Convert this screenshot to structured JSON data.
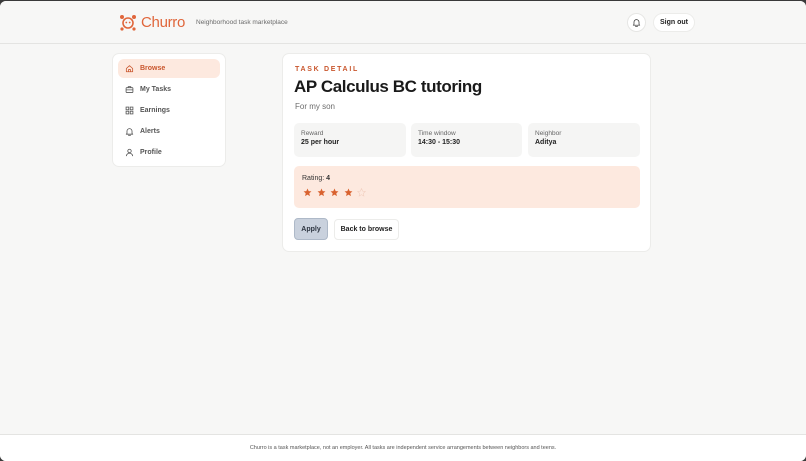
{
  "header": {
    "brand_name": "Churro",
    "tagline": "Neighborhood task marketplace",
    "sign_out_label": "Sign out",
    "brand_color": "#e0663b"
  },
  "sidebar": {
    "items": [
      {
        "label": "Browse",
        "icon": "home-icon",
        "active": true
      },
      {
        "label": "My Tasks",
        "icon": "briefcase-icon",
        "active": false
      },
      {
        "label": "Earnings",
        "icon": "grid-icon",
        "active": false
      },
      {
        "label": "Alerts",
        "icon": "bell-icon",
        "active": false
      },
      {
        "label": "Profile",
        "icon": "user-icon",
        "active": false
      }
    ]
  },
  "task": {
    "eyebrow": "TASK DETAIL",
    "title": "AP Calculus BC tutoring",
    "subtitle": "For my son",
    "reward_label": "Reward",
    "reward_value": "25 per hour",
    "time_label": "Time window",
    "time_value": "14:30 - 15:30",
    "neighbor_label": "Neighbor",
    "neighbor_value": "Aditya",
    "rating_label": "Rating:",
    "rating_value": "4",
    "rating_max": 5,
    "apply_label": "Apply",
    "back_label": "Back to browse",
    "accent_color": "#c9562d",
    "star_color": "#d9622f"
  },
  "footer": {
    "text": "Churro is a task marketplace, not an employer. All tasks are independent service arrangements between neighbors and teens."
  }
}
